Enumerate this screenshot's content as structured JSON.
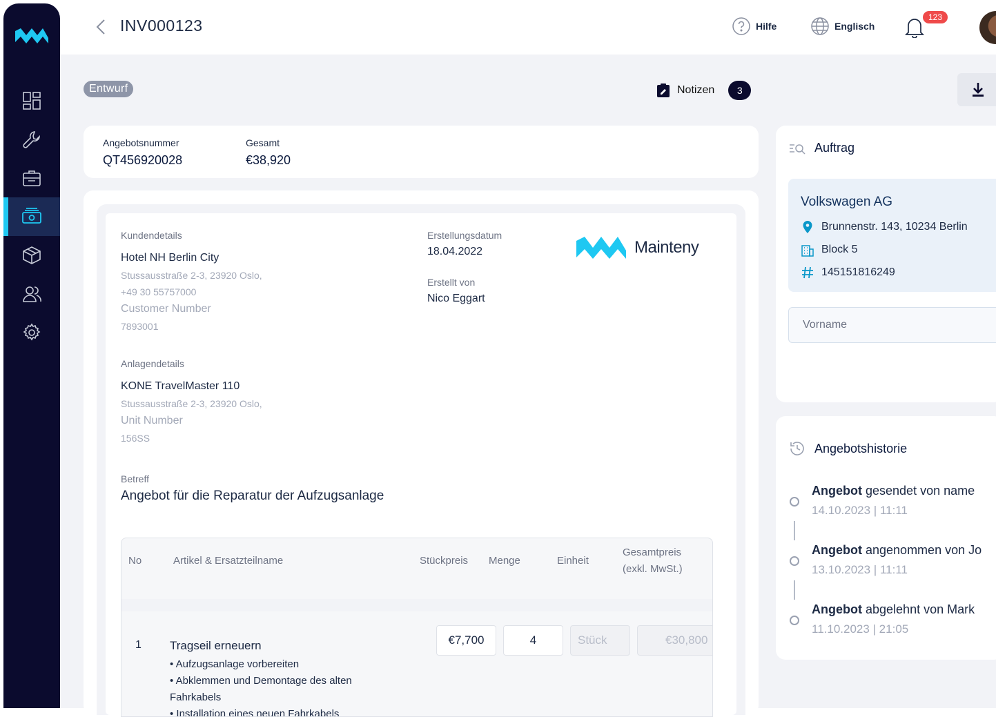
{
  "header": {
    "title": "INV000123",
    "help_label": "Hilfe",
    "language_label": "Englisch",
    "notification_count": "123"
  },
  "toolbar": {
    "status": "Entwurf",
    "notes_label": "Notizen",
    "notes_count": "3"
  },
  "summary": {
    "quote_number_label": "Angebotsnummer",
    "quote_number": "QT456920028",
    "total_label": "Gesamt",
    "total": "€38,920"
  },
  "document": {
    "customer_label": "Kundendetails",
    "customer_name": "Hotel NH Berlin City",
    "customer_address": "Stussausstraße 2-3, 23920 Oslo,",
    "customer_phone": "+49 30 55757000",
    "customer_number_label": "Customer Number",
    "customer_number": "7893001",
    "created_date_label": "Erstellungsdatum",
    "created_date": "18.04.2022",
    "created_by_label": "Erstellt von",
    "created_by": "Nico Eggart",
    "brand_name": "Mainteny",
    "asset_label": "Anlagendetails",
    "asset_name": "KONE TravelMaster 110",
    "asset_address": "Stussausstraße 2-3, 23920 Oslo,",
    "unit_number_label": "Unit Number",
    "unit_number": "156SS",
    "subject_label": "Betreff",
    "subject": "Angebot für die Reparatur der Aufzugsanlage"
  },
  "table": {
    "headers": {
      "no": "No",
      "item": "Artikel & Ersatzteilname",
      "unit_price": "Stückpreis",
      "quantity": "Menge",
      "unit": "Einheit",
      "total_line1": "Gesamtpreis",
      "total_line2": "(exkl. MwSt.)"
    },
    "rows": [
      {
        "no": "1",
        "title": "Tragseil erneuern",
        "bullets": [
          "Aufzugsanlage vorbereiten",
          "Abklemmen und Demontage des alten Fahrkabels",
          "Installation eines neuen Fahrkabels"
        ],
        "unit_price": "€7,700",
        "quantity": "4",
        "unit": "Stück",
        "total": "€30,800"
      }
    ]
  },
  "order": {
    "title": "Auftrag",
    "company": "Volkswagen AG",
    "address": "Brunnenstr. 143, 10234 Berlin",
    "block": "Block 5",
    "number": "145151816249",
    "first_name_placeholder": "Vorname"
  },
  "history": {
    "title": "Angebotshistorie",
    "items": [
      {
        "action": "Angebot",
        "text": "gesendet von name",
        "date": "14.10.2023 | 11:11"
      },
      {
        "action": "Angebot",
        "text": "angenommen von Jo",
        "date": "13.10.2023 | 11:11"
      },
      {
        "action": "Angebot",
        "text": "abgelehnt von Mark",
        "date": "11.10.2023 | 21:05"
      }
    ]
  },
  "colors": {
    "sidebar_bg": "#0b0b2e",
    "accent": "#1ec8f2",
    "status_badge": "#8e95a8",
    "notification": "#ef4a4a"
  },
  "icons": [
    "mainteny-logo-icon",
    "dashboard-icon",
    "wrench-icon",
    "briefcase-icon",
    "money-icon",
    "box-icon",
    "users-icon",
    "gear-icon",
    "chevron-left-icon",
    "help-icon",
    "globe-icon",
    "bell-icon",
    "notes-icon",
    "download-icon",
    "search-list-icon",
    "location-icon",
    "building-icon",
    "hash-icon",
    "history-icon"
  ]
}
